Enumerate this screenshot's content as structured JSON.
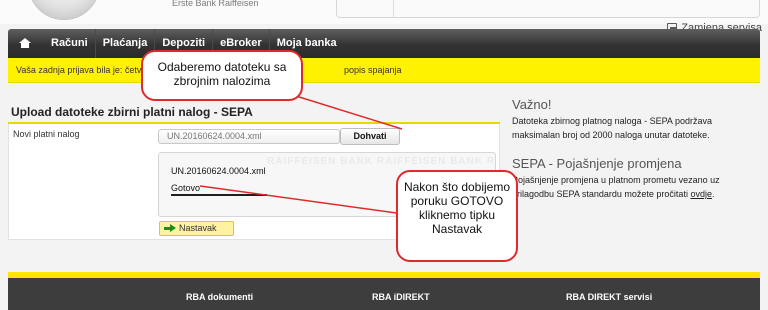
{
  "top": {
    "logo_subtitle": "Erste Bank Raiffeisen",
    "change_service_label": "Zamjena servisa"
  },
  "nav": {
    "items": [
      "Računi",
      "Plaćanja",
      "Depoziti",
      "eBroker",
      "Moja banka"
    ]
  },
  "notice": {
    "last_login": "Vaša zadnja prijava bila je: četv",
    "tail": "popis spajanja"
  },
  "upload": {
    "title": "Upload datoteke zbirni platni nalog - SEPA",
    "new_order_label": "Novi platni nalog",
    "file_value": "UN.20160624.0004.xml",
    "fetch_label": "Dohvati",
    "status_filename": "UN.20160624.0004.xml",
    "status_text": "Gotovo",
    "watermark": "RAIFFEISEN BANK RAIFFEISEN BANK RAIFFEISEN",
    "continue_label": "Nastavak"
  },
  "info": {
    "important_title": "Važno!",
    "important_text": "Datoteka zbirnog platnog naloga - SEPA podržava maksimalan broj od 2000 naloga unutar datoteke.",
    "sepa_title": "SEPA - Pojašnjenje promjena",
    "sepa_text": "Pojašnjenje promjena u platnom prometu vezano uz prilagodbu SEPA standardu možete pročitati",
    "sepa_link": "ovdje"
  },
  "footer": {
    "columns": [
      "RBA dokumenti",
      "RBA iDIREKT",
      "RBA DIREKT servisi"
    ]
  },
  "callouts": {
    "first": "Odaberemo datoteku sa zbrojnim nalozima",
    "second": "Nakon što dobijemo poruku GOTOVO kliknemo tipku Nastavak"
  },
  "colors": {
    "accent_yellow": "#fff200",
    "nav_dark": "#333333",
    "callout_red": "#e02a2a",
    "arrow_green": "#1f8a1f"
  },
  "icons": [
    "home-icon",
    "exit-icon",
    "arrow-right-icon"
  ]
}
